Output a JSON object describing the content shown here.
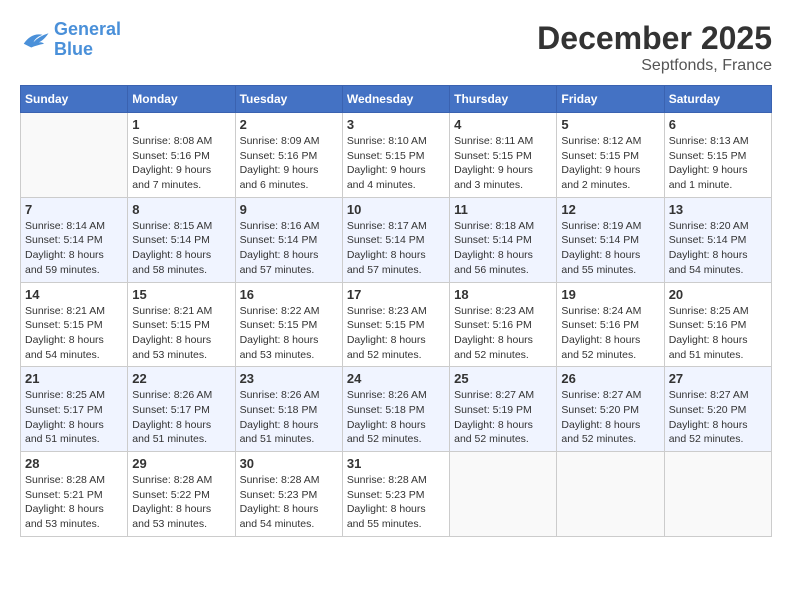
{
  "header": {
    "logo": {
      "line1": "General",
      "line2": "Blue"
    },
    "title": "December 2025",
    "location": "Septfonds, France"
  },
  "days_of_week": [
    "Sunday",
    "Monday",
    "Tuesday",
    "Wednesday",
    "Thursday",
    "Friday",
    "Saturday"
  ],
  "weeks": [
    {
      "days": [
        {
          "number": "",
          "info": ""
        },
        {
          "number": "1",
          "info": "Sunrise: 8:08 AM\nSunset: 5:16 PM\nDaylight: 9 hours\nand 7 minutes."
        },
        {
          "number": "2",
          "info": "Sunrise: 8:09 AM\nSunset: 5:16 PM\nDaylight: 9 hours\nand 6 minutes."
        },
        {
          "number": "3",
          "info": "Sunrise: 8:10 AM\nSunset: 5:15 PM\nDaylight: 9 hours\nand 4 minutes."
        },
        {
          "number": "4",
          "info": "Sunrise: 8:11 AM\nSunset: 5:15 PM\nDaylight: 9 hours\nand 3 minutes."
        },
        {
          "number": "5",
          "info": "Sunrise: 8:12 AM\nSunset: 5:15 PM\nDaylight: 9 hours\nand 2 minutes."
        },
        {
          "number": "6",
          "info": "Sunrise: 8:13 AM\nSunset: 5:15 PM\nDaylight: 9 hours\nand 1 minute."
        }
      ]
    },
    {
      "days": [
        {
          "number": "7",
          "info": "Sunrise: 8:14 AM\nSunset: 5:14 PM\nDaylight: 8 hours\nand 59 minutes."
        },
        {
          "number": "8",
          "info": "Sunrise: 8:15 AM\nSunset: 5:14 PM\nDaylight: 8 hours\nand 58 minutes."
        },
        {
          "number": "9",
          "info": "Sunrise: 8:16 AM\nSunset: 5:14 PM\nDaylight: 8 hours\nand 57 minutes."
        },
        {
          "number": "10",
          "info": "Sunrise: 8:17 AM\nSunset: 5:14 PM\nDaylight: 8 hours\nand 57 minutes."
        },
        {
          "number": "11",
          "info": "Sunrise: 8:18 AM\nSunset: 5:14 PM\nDaylight: 8 hours\nand 56 minutes."
        },
        {
          "number": "12",
          "info": "Sunrise: 8:19 AM\nSunset: 5:14 PM\nDaylight: 8 hours\nand 55 minutes."
        },
        {
          "number": "13",
          "info": "Sunrise: 8:20 AM\nSunset: 5:14 PM\nDaylight: 8 hours\nand 54 minutes."
        }
      ]
    },
    {
      "days": [
        {
          "number": "14",
          "info": "Sunrise: 8:21 AM\nSunset: 5:15 PM\nDaylight: 8 hours\nand 54 minutes."
        },
        {
          "number": "15",
          "info": "Sunrise: 8:21 AM\nSunset: 5:15 PM\nDaylight: 8 hours\nand 53 minutes."
        },
        {
          "number": "16",
          "info": "Sunrise: 8:22 AM\nSunset: 5:15 PM\nDaylight: 8 hours\nand 53 minutes."
        },
        {
          "number": "17",
          "info": "Sunrise: 8:23 AM\nSunset: 5:15 PM\nDaylight: 8 hours\nand 52 minutes."
        },
        {
          "number": "18",
          "info": "Sunrise: 8:23 AM\nSunset: 5:16 PM\nDaylight: 8 hours\nand 52 minutes."
        },
        {
          "number": "19",
          "info": "Sunrise: 8:24 AM\nSunset: 5:16 PM\nDaylight: 8 hours\nand 52 minutes."
        },
        {
          "number": "20",
          "info": "Sunrise: 8:25 AM\nSunset: 5:16 PM\nDaylight: 8 hours\nand 51 minutes."
        }
      ]
    },
    {
      "days": [
        {
          "number": "21",
          "info": "Sunrise: 8:25 AM\nSunset: 5:17 PM\nDaylight: 8 hours\nand 51 minutes."
        },
        {
          "number": "22",
          "info": "Sunrise: 8:26 AM\nSunset: 5:17 PM\nDaylight: 8 hours\nand 51 minutes."
        },
        {
          "number": "23",
          "info": "Sunrise: 8:26 AM\nSunset: 5:18 PM\nDaylight: 8 hours\nand 51 minutes."
        },
        {
          "number": "24",
          "info": "Sunrise: 8:26 AM\nSunset: 5:18 PM\nDaylight: 8 hours\nand 52 minutes."
        },
        {
          "number": "25",
          "info": "Sunrise: 8:27 AM\nSunset: 5:19 PM\nDaylight: 8 hours\nand 52 minutes."
        },
        {
          "number": "26",
          "info": "Sunrise: 8:27 AM\nSunset: 5:20 PM\nDaylight: 8 hours\nand 52 minutes."
        },
        {
          "number": "27",
          "info": "Sunrise: 8:27 AM\nSunset: 5:20 PM\nDaylight: 8 hours\nand 52 minutes."
        }
      ]
    },
    {
      "days": [
        {
          "number": "28",
          "info": "Sunrise: 8:28 AM\nSunset: 5:21 PM\nDaylight: 8 hours\nand 53 minutes."
        },
        {
          "number": "29",
          "info": "Sunrise: 8:28 AM\nSunset: 5:22 PM\nDaylight: 8 hours\nand 53 minutes."
        },
        {
          "number": "30",
          "info": "Sunrise: 8:28 AM\nSunset: 5:23 PM\nDaylight: 8 hours\nand 54 minutes."
        },
        {
          "number": "31",
          "info": "Sunrise: 8:28 AM\nSunset: 5:23 PM\nDaylight: 8 hours\nand 55 minutes."
        },
        {
          "number": "",
          "info": ""
        },
        {
          "number": "",
          "info": ""
        },
        {
          "number": "",
          "info": ""
        }
      ]
    }
  ]
}
